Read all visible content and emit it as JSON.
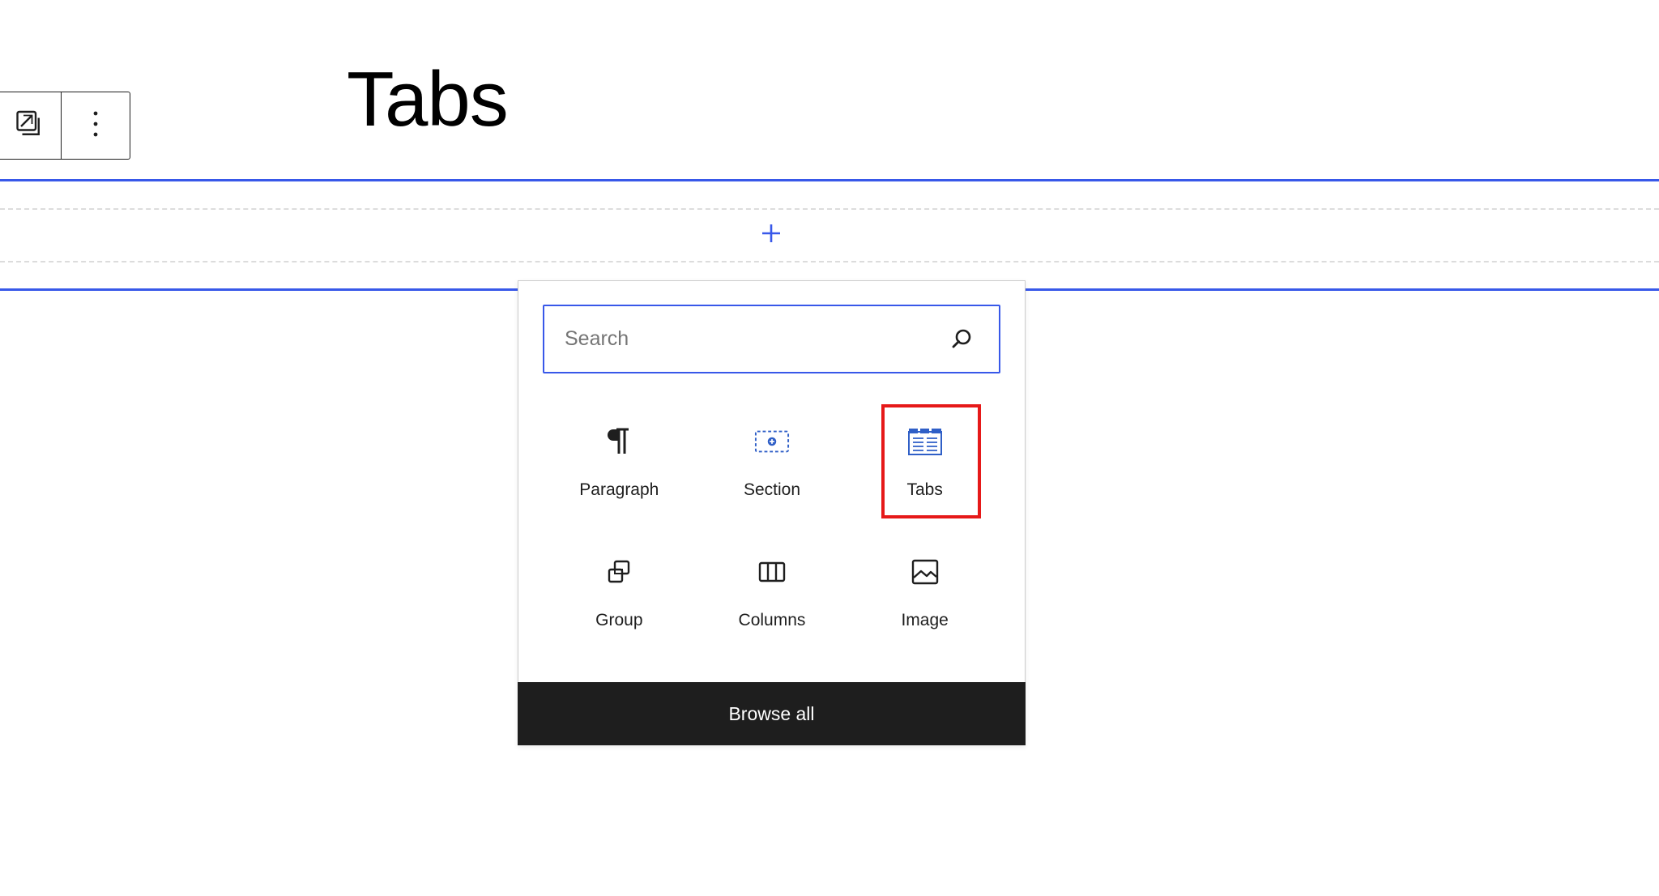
{
  "page": {
    "title": "Tabs"
  },
  "toolbar": {
    "transform_icon": "block-transform-icon",
    "options_icon": "more-vertical-icon"
  },
  "appender": {
    "icon": "plus-icon"
  },
  "inserter": {
    "search": {
      "placeholder": "Search",
      "value": "",
      "icon": "search-icon"
    },
    "blocks": [
      {
        "label": "Paragraph",
        "icon": "paragraph-icon"
      },
      {
        "label": "Section",
        "icon": "section-icon"
      },
      {
        "label": "Tabs",
        "icon": "tabs-icon",
        "highlighted": true
      },
      {
        "label": "Group",
        "icon": "group-icon"
      },
      {
        "label": "Columns",
        "icon": "columns-icon"
      },
      {
        "label": "Image",
        "icon": "image-icon"
      }
    ],
    "browse_all_label": "Browse all"
  },
  "colors": {
    "accent": "#3858e9",
    "highlight": "#e61919",
    "dark": "#1e1e1e"
  }
}
